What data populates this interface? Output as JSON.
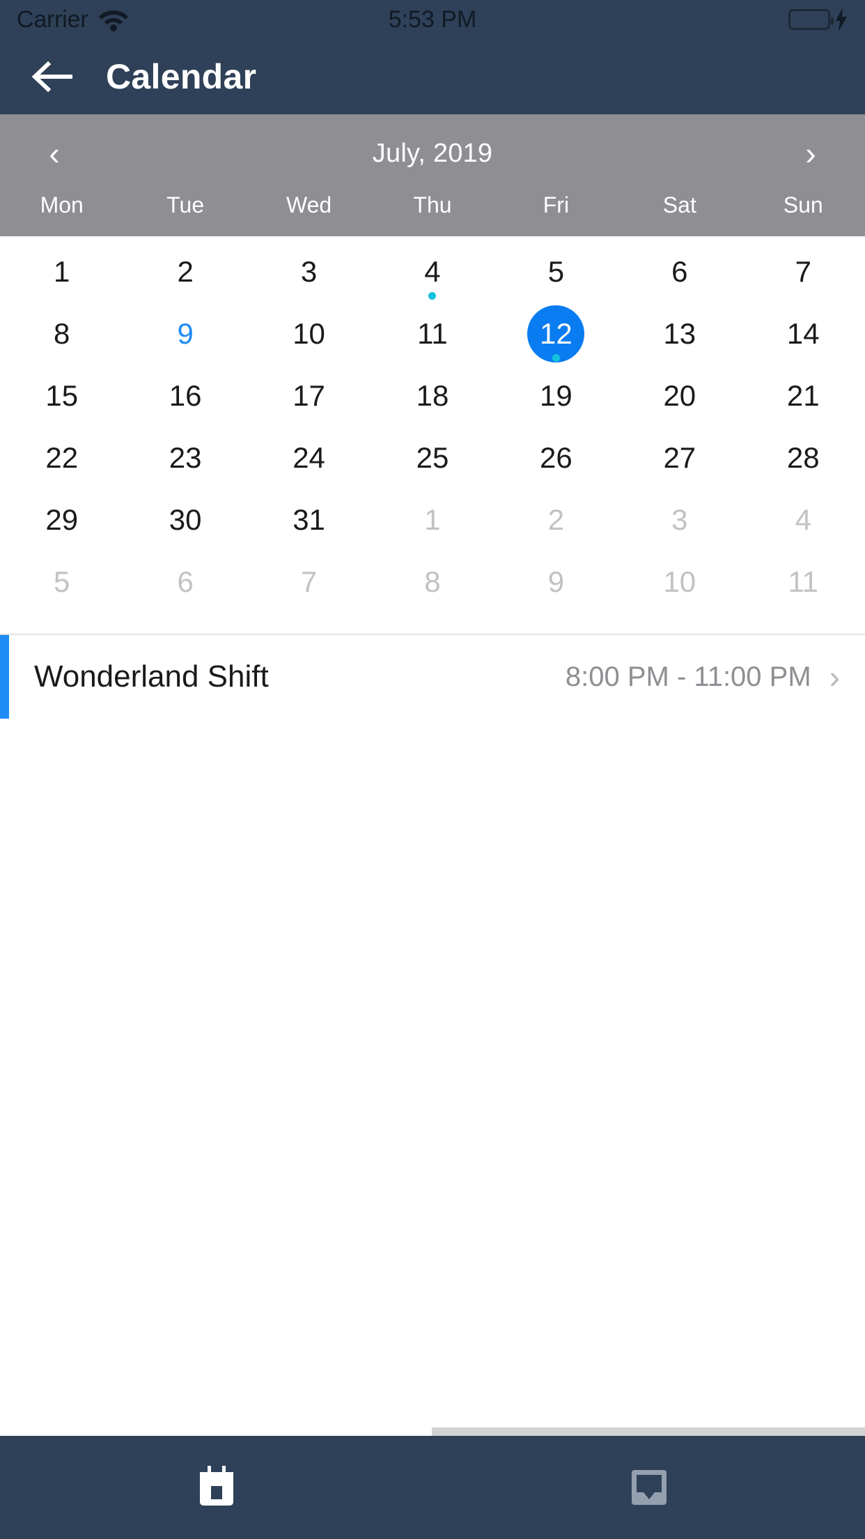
{
  "status_bar": {
    "carrier": "Carrier",
    "time": "5:53 PM",
    "wifi_icon": "wifi-icon",
    "battery_icon": "battery-icon",
    "charging_icon": "lightning-bolt-icon",
    "battery_color": "#3de04f"
  },
  "nav_bar": {
    "back_icon": "back-arrow-icon",
    "title": "Calendar",
    "background_color": "#2f4158"
  },
  "calendar": {
    "header_background": "#8e8e93",
    "prev_icon": "chevron-left-icon",
    "next_icon": "chevron-right-icon",
    "month_label": "July, 2019",
    "weekdays": [
      "Mon",
      "Tue",
      "Wed",
      "Thu",
      "Fri",
      "Sat",
      "Sun"
    ],
    "selected_color": "#0a7cf1",
    "today_color": "#1f8cf5",
    "event_dot_color": "#15c2de",
    "other_month_color": "#c2c2c4",
    "weeks": [
      [
        {
          "day": "1",
          "state": "current"
        },
        {
          "day": "2",
          "state": "current"
        },
        {
          "day": "3",
          "state": "current"
        },
        {
          "day": "4",
          "state": "current",
          "dot": "below"
        },
        {
          "day": "5",
          "state": "current"
        },
        {
          "day": "6",
          "state": "current"
        },
        {
          "day": "7",
          "state": "current"
        }
      ],
      [
        {
          "day": "8",
          "state": "current"
        },
        {
          "day": "9",
          "state": "today"
        },
        {
          "day": "10",
          "state": "current"
        },
        {
          "day": "11",
          "state": "current"
        },
        {
          "day": "12",
          "state": "selected",
          "dot": "below"
        },
        {
          "day": "13",
          "state": "current"
        },
        {
          "day": "14",
          "state": "current"
        }
      ],
      [
        {
          "day": "15",
          "state": "current"
        },
        {
          "day": "16",
          "state": "current"
        },
        {
          "day": "17",
          "state": "current"
        },
        {
          "day": "18",
          "state": "current"
        },
        {
          "day": "19",
          "state": "current"
        },
        {
          "day": "20",
          "state": "current"
        },
        {
          "day": "21",
          "state": "current"
        }
      ],
      [
        {
          "day": "22",
          "state": "current"
        },
        {
          "day": "23",
          "state": "current"
        },
        {
          "day": "24",
          "state": "current"
        },
        {
          "day": "25",
          "state": "current"
        },
        {
          "day": "26",
          "state": "current"
        },
        {
          "day": "27",
          "state": "current"
        },
        {
          "day": "28",
          "state": "current"
        }
      ],
      [
        {
          "day": "29",
          "state": "current"
        },
        {
          "day": "30",
          "state": "current"
        },
        {
          "day": "31",
          "state": "current"
        },
        {
          "day": "1",
          "state": "other"
        },
        {
          "day": "2",
          "state": "other"
        },
        {
          "day": "3",
          "state": "other"
        },
        {
          "day": "4",
          "state": "other"
        }
      ],
      [
        {
          "day": "5",
          "state": "other"
        },
        {
          "day": "6",
          "state": "other"
        },
        {
          "day": "7",
          "state": "other"
        },
        {
          "day": "8",
          "state": "other"
        },
        {
          "day": "9",
          "state": "other"
        },
        {
          "day": "10",
          "state": "other"
        },
        {
          "day": "11",
          "state": "other"
        }
      ]
    ]
  },
  "events": [
    {
      "title": "Wonderland Shift",
      "time": "8:00 PM - 11:00 PM",
      "accent_color": "#1f8cf5",
      "chevron_icon": "chevron-right-icon"
    }
  ],
  "tab_bar": {
    "background_color": "#2f4158",
    "items": [
      {
        "icon": "calendar-icon",
        "active": true
      },
      {
        "icon": "inbox-tray-icon",
        "active": false
      }
    ]
  }
}
